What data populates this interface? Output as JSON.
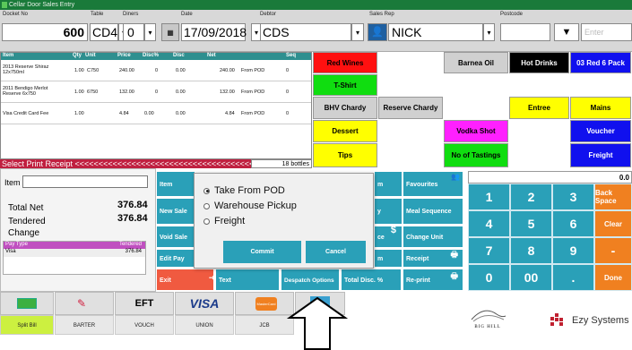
{
  "window": {
    "title": "Cellar Door Sales Entry"
  },
  "header": {
    "labels": {
      "docket": "Docket No",
      "table": "Table",
      "diners": "Diners",
      "date": "Date",
      "debtor": "Debtor",
      "rep": "Sales Rep",
      "postcode": "Postcode"
    },
    "docket_no": "600",
    "table": "CD4",
    "diners": "0",
    "date": "17/09/2018",
    "debtor": "CDS",
    "sales_rep": "NICK",
    "postcode": "",
    "enter_label": "Enter"
  },
  "grid": {
    "columns": [
      "Item",
      "Qty",
      "Unit",
      "Price",
      "Disc%",
      "Disc",
      "Net",
      "",
      "Seq"
    ],
    "rows": [
      {
        "item": "2013 Reserve Shiraz 12x750ml",
        "qty": "1.00",
        "unit": "C750",
        "price": "240.00",
        "disc_pct": "0",
        "disc": "0.00",
        "net": "240.00",
        "src": "From POD",
        "seq": "0"
      },
      {
        "item": "2011 Bendigo Merlot Reserve 6x750",
        "qty": "1.00",
        "unit": "6750",
        "price": "132.00",
        "disc_pct": "0",
        "disc": "0.00",
        "net": "132.00",
        "src": "From POD",
        "seq": "0"
      },
      {
        "item": "Visa Credit Card Fee",
        "qty": "1.00",
        "unit": "",
        "price": "4.84",
        "disc_pct": "0.00",
        "disc": "0.00",
        "net": "4.84",
        "src": "From POD",
        "seq": "0"
      }
    ],
    "ticker": "Select Print Receipt <<<<<<<<<<<<<<<<<<<<<<<<<<<<<<<<<<<<<<<<<<<<",
    "bottles": "18 bottles"
  },
  "categories": [
    {
      "label": "Red Wines",
      "bg": "#ff1010",
      "fg": "#000"
    },
    {
      "label": "Barnea Oil",
      "bg": "#d0d0d0",
      "fg": "#000"
    },
    {
      "label": "Hot Drinks",
      "bg": "#000000",
      "fg": "#fff"
    },
    {
      "label": "03 Red 6 Pack",
      "bg": "#1010ee",
      "fg": "#fff"
    },
    {
      "label": "T-Shirt",
      "bg": "#10dd10",
      "fg": "#000"
    },
    {
      "label": "BHV Chardy",
      "bg": "#d0d0d0",
      "fg": "#000"
    },
    {
      "label": "Reserve Chardy",
      "bg": "#d0d0d0",
      "fg": "#000"
    },
    {
      "label": "Entree",
      "bg": "#ffff00",
      "fg": "#000"
    },
    {
      "label": "Mains",
      "bg": "#ffff00",
      "fg": "#000"
    },
    {
      "label": "Dessert",
      "bg": "#ffff00",
      "fg": "#000"
    },
    {
      "label": "Vodka Shot",
      "bg": "#ff20ff",
      "fg": "#000"
    },
    {
      "label": "Voucher",
      "bg": "#1010ee",
      "fg": "#fff"
    },
    {
      "label": "Tips",
      "bg": "#ffff00",
      "fg": "#000"
    },
    {
      "label": "No of Tastings",
      "bg": "#10dd10",
      "fg": "#000"
    },
    {
      "label": "Freight",
      "bg": "#1010ee",
      "fg": "#fff"
    }
  ],
  "totals": {
    "item_label": "Item",
    "total_net_label": "Total Net",
    "total_net": "376.84",
    "tendered_label": "Tendered",
    "tendered": "376.84",
    "change_label": "Change",
    "change": ""
  },
  "payments": {
    "col1": "Pay Type",
    "col2": "Tendered",
    "rows": [
      {
        "type": "Visa",
        "amount": "376.84"
      }
    ]
  },
  "tools": {
    "item_search": "Item Search",
    "new_sale": "New Sale",
    "void_sale": "Void Sale",
    "edit_pay": "Edit Pay",
    "exit": "Exit",
    "text": "Text",
    "despatch": "Despatch Options",
    "total_disc": "Total Disc. %",
    "favourites": "Favourites",
    "meal_seq": "Meal Sequence",
    "change_unit": "Change Unit",
    "receipt": "Receipt",
    "reprint": "Re-print",
    "item_frag": "m",
    "y_frag": "y",
    "ce_frag": "ce",
    "m2_frag": "m"
  },
  "keypad": {
    "display": "0.0",
    "keys": [
      "1",
      "2",
      "3",
      "Back Space",
      "4",
      "5",
      "6",
      "Clear",
      "7",
      "8",
      "9",
      "-",
      "0",
      "00",
      ".",
      "Done"
    ]
  },
  "dialog": {
    "options": [
      "Take From POD",
      "Warehouse Pickup",
      "Freight"
    ],
    "selected": 0,
    "commit": "Commit",
    "cancel": "Cancel"
  },
  "tender_tabs": [
    "Split Bill",
    "BARTER",
    "VOUCH",
    "UNION",
    "JCB"
  ],
  "tender_icons": {
    "eft": "EFT",
    "visa": "VISA",
    "mc": "MasterCard"
  },
  "brand": {
    "vendor": "Ezy Systems",
    "winery": "BIG HILL"
  }
}
